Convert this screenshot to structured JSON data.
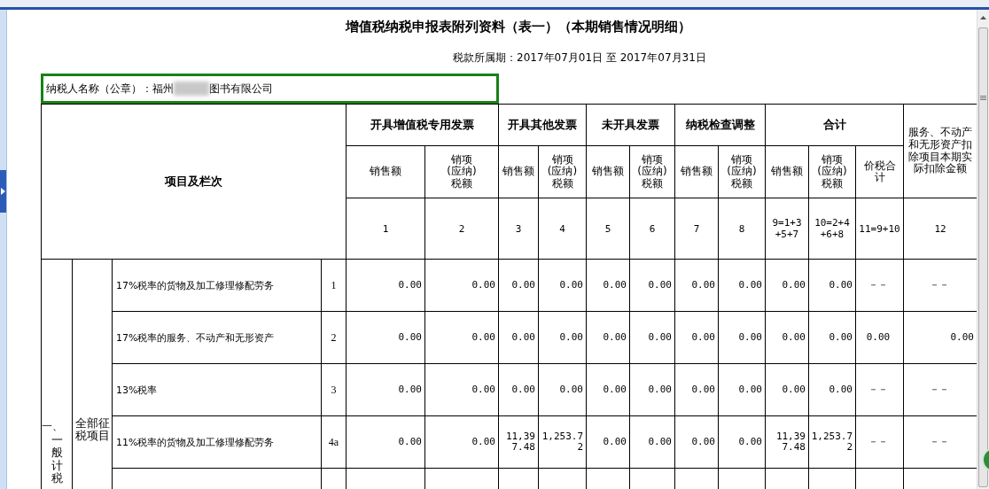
{
  "title": "增值税纳税申报表附列资料（表一）（本期销售情况明细）",
  "period": "税款所属期：2017年07月01日 至 2017年07月31日",
  "taxpayer": {
    "label": "纳税人名称（公章）：福州",
    "name_tail": "图书有限公司",
    "redacted": true
  },
  "table": {
    "corner": "项目及栏次",
    "groups": [
      {
        "label": "开具增值税专用发票",
        "columns": [
          "销售额",
          "销项(应纳)税额"
        ]
      },
      {
        "label": "开具其他发票",
        "columns": [
          "销售额",
          "销项(应纳)税额"
        ]
      },
      {
        "label": "未开具发票",
        "columns": [
          "销售额",
          "销项(应纳)税额"
        ]
      },
      {
        "label": "纳税检查调整",
        "columns": [
          "销售额",
          "销项(应纳)税额"
        ]
      },
      {
        "label": "合计",
        "columns": [
          "销售额",
          "销项(应纳)税额",
          "价税合计"
        ]
      }
    ],
    "extra_column": "服务、不动产和无形资产扣除项目本期实际扣除金额",
    "column_numbers": [
      "1",
      "2",
      "3",
      "4",
      "5",
      "6",
      "7",
      "8",
      "9=1+3\n+5+7",
      "10=2+4\n+6+8",
      "11=9+10",
      "12"
    ],
    "section_mark": "一、",
    "section_name": "一般计税",
    "category": "全部征税项目",
    "rows": [
      {
        "label": "17%税率的货物及加工修理修配劳务",
        "line": "1",
        "values": [
          "0.00",
          "0.00",
          "0.00",
          "0.00",
          "0.00",
          "0.00",
          "0.00",
          "0.00",
          "0.00",
          "0.00",
          "－－",
          "－－"
        ]
      },
      {
        "label": "17%税率的服务、不动产和无形资产",
        "line": "2",
        "values": [
          "0.00",
          "0.00",
          "0.00",
          "0.00",
          "0.00",
          "0.00",
          "0.00",
          "0.00",
          "0.00",
          "0.00",
          "0.00",
          "0.00"
        ]
      },
      {
        "label": "13%税率",
        "line": "3",
        "values": [
          "0.00",
          "0.00",
          "0.00",
          "0.00",
          "0.00",
          "0.00",
          "0.00",
          "0.00",
          "0.00",
          "0.00",
          "－－",
          "－－"
        ]
      },
      {
        "label": "11%税率的货物及加工修理修配劳务",
        "line": "4a",
        "values": [
          "0.00",
          "0.00",
          "11,397.48",
          "1,253.72",
          "0.00",
          "0.00",
          "0.00",
          "0.00",
          "11,397.48",
          "1,253.72",
          "－－",
          "－－"
        ]
      }
    ]
  }
}
